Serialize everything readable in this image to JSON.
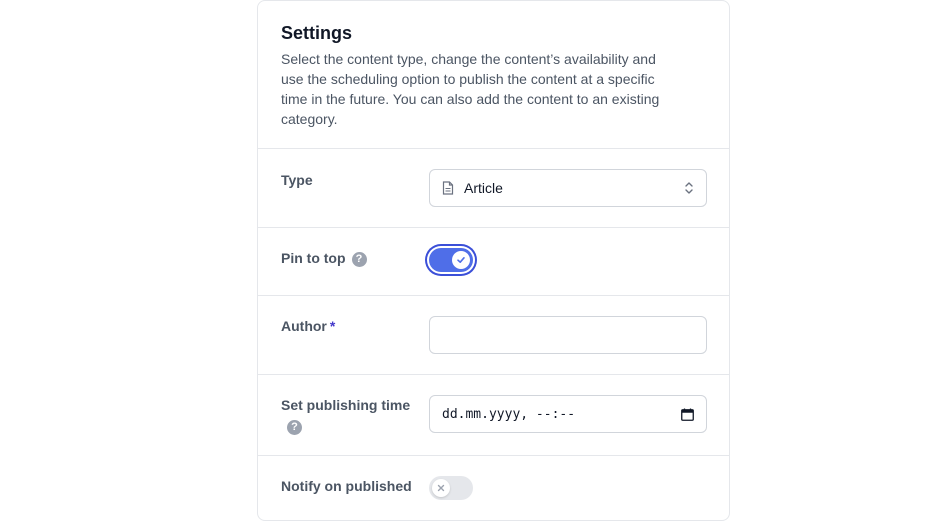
{
  "settings": {
    "title": "Settings",
    "description": "Select the content type, change the content’s availability and use the scheduling option to publish the content at a specific time in the future. You can also add the content to an existing category.",
    "type": {
      "label": "Type",
      "value": "Article",
      "icon": "document-icon"
    },
    "pin_to_top": {
      "label": "Pin to top",
      "help": "?",
      "enabled": true
    },
    "author": {
      "label": "Author",
      "required_mark": "*",
      "value": ""
    },
    "publishing_time": {
      "label": "Set publishing time",
      "help": "?",
      "placeholder": "dd.mm.yyyy, --:--"
    },
    "notify": {
      "label": "Notify on published",
      "enabled": false
    }
  },
  "colors": {
    "accent": "#4f6ee8",
    "required": "#4338ca",
    "border": "#e5e7eb"
  }
}
